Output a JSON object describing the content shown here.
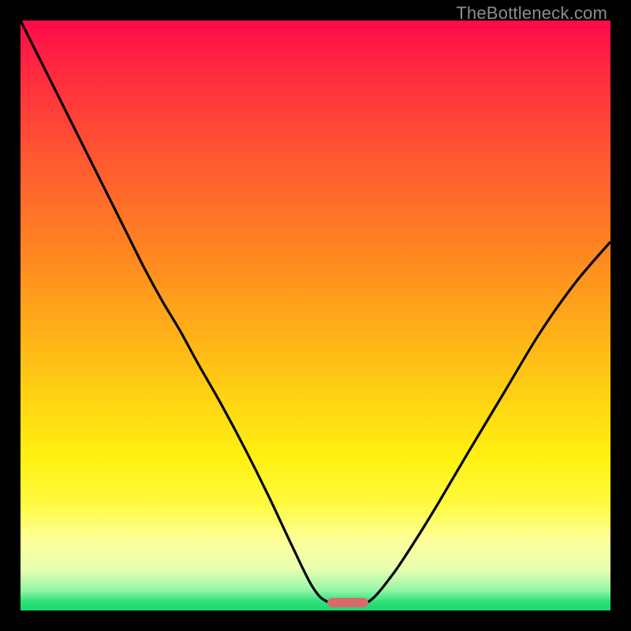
{
  "watermark": "TheBottleneck.com",
  "colors": {
    "frame": "#000000",
    "curve": "#000000",
    "marker": "#d86a6a",
    "watermark": "#8d8d8d"
  },
  "layout": {
    "image_size": 800,
    "margin": 26,
    "plot_size": 748
  },
  "marker": {
    "x_frac_start": 0.52,
    "x_frac_end": 0.59,
    "y_frac": 0.986
  },
  "chart_data": {
    "type": "line",
    "title": "",
    "xlabel": "",
    "ylabel": "",
    "xlim": [
      0,
      1
    ],
    "ylim": [
      0,
      1
    ],
    "series": [
      {
        "name": "left-branch",
        "x": [
          0.0,
          0.03,
          0.06,
          0.09,
          0.12,
          0.15,
          0.18,
          0.21,
          0.24,
          0.27,
          0.3,
          0.34,
          0.38,
          0.42,
          0.46,
          0.495,
          0.52
        ],
        "y": [
          1.0,
          0.94,
          0.88,
          0.82,
          0.76,
          0.7,
          0.64,
          0.58,
          0.525,
          0.475,
          0.42,
          0.35,
          0.275,
          0.195,
          0.11,
          0.04,
          0.015
        ]
      },
      {
        "name": "valley",
        "x": [
          0.52,
          0.555,
          0.59
        ],
        "y": [
          0.015,
          0.014,
          0.015
        ]
      },
      {
        "name": "right-branch",
        "x": [
          0.59,
          0.63,
          0.67,
          0.71,
          0.76,
          0.82,
          0.88,
          0.94,
          1.0
        ],
        "y": [
          0.015,
          0.06,
          0.12,
          0.185,
          0.27,
          0.37,
          0.47,
          0.555,
          0.625
        ]
      }
    ],
    "annotations": []
  }
}
